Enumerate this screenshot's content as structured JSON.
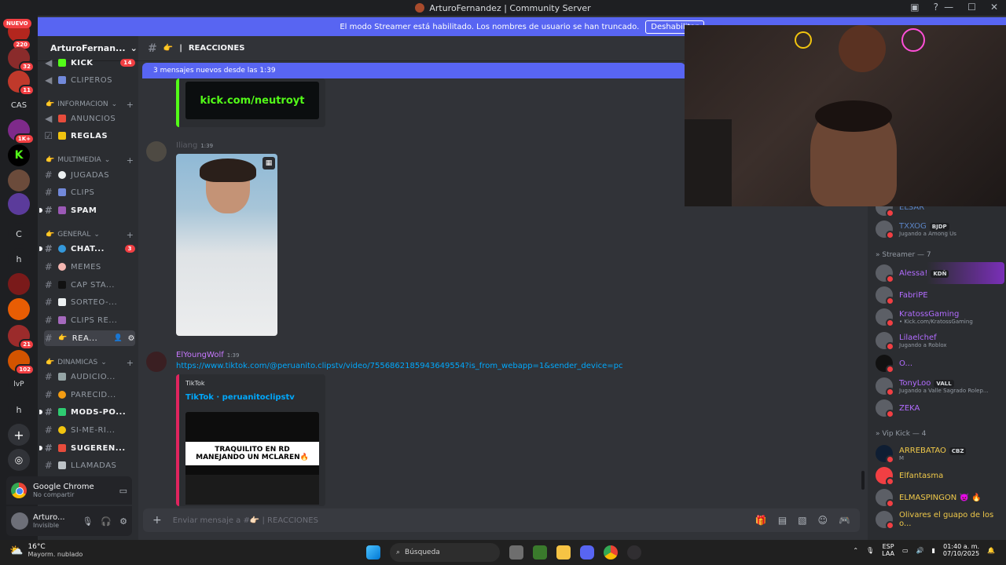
{
  "window": {
    "title": "ArturoFernandez | Community Server"
  },
  "banner": {
    "text": "El modo Streamer está habilitado. Los nombres de usuario se han truncado.",
    "button": "Deshabilitar"
  },
  "rail": {
    "nuevo": "NUEVO",
    "badge_220": "220",
    "badge_32": "32",
    "badge_11": "11",
    "cas": "CAS",
    "badge_1k": "1K+",
    "c": "C",
    "h": "h",
    "badge_21": "21",
    "badge_102": "102",
    "lvp": "lvP",
    "h2": "h"
  },
  "guild": {
    "name": "ArturoFernan..."
  },
  "channels": {
    "kick": "KICK",
    "kick_badge": "14",
    "clipers": "CLIPEROS",
    "cat_info": "INFORMACION",
    "anuncios": "ANUNCIOS",
    "reglas": "REGLAS",
    "cat_multi": "MULTIMEDIA",
    "jugadas": "JUGADAS",
    "clips": "CLIPS",
    "spam": "SPAM",
    "cat_general": "GENERAL",
    "chat": "CHAT...",
    "chat_badge": "3",
    "memes": "MEMES",
    "capsta": "CAP STA...",
    "sorteo": "SORTEO-...",
    "clipsre": "CLIPS RE...",
    "rea": "REA...",
    "cat_din": "DINAMICAS",
    "audicio": "AUDICIO...",
    "parecid": "PARECID...",
    "mods": "MODS-PO...",
    "sime": "SI-ME-RI...",
    "sugeren": "SUGEREN...",
    "llamadas": "LLAMADAS"
  },
  "share_panel": {
    "title": "Google Chrome",
    "subtitle": "No compartir"
  },
  "user_panel": {
    "name": "Arturo...",
    "status": "Invisible"
  },
  "chat": {
    "channel": "REACCIONES",
    "new_messages": "3 mensajes nuevos desde las 1:39",
    "kick_embed_text": "kick.com/neutroyt",
    "msg1_author": "Iliang",
    "msg1_time": "1:39",
    "msg2_author": "ElYoungWolf",
    "msg2_time": "1:39",
    "msg2_link": "https://www.tiktok.com/@peruanito.clipstv/video/7556862185943649554?is_from_webapp=1&sender_device=pc",
    "embed_provider": "TikTok",
    "embed_title": "TikTok · peruanitoclipstv",
    "thumb_line1": "TRAQUILITO EN RD",
    "thumb_line2": "MANEJANDO UN MCLAREN🔥",
    "composer_placeholder": "Enviar mensaje a #👉🏻 | REACCIONES"
  },
  "members": {
    "m_elsar": "ELSAR",
    "m_txxog": "TXXOG",
    "m_txxog_tag": "BJDP",
    "m_txxog_act": "Jugando a Among Us",
    "group_streamer": "» Streamer — 7",
    "m_alessa": "Alessa!",
    "m_alessa_tag": "KDÑ",
    "m_fabri": "FabriPE",
    "m_kratoss": "KratossGaming",
    "m_kratoss_act": "• Kick.com/KratossGaming",
    "m_lilael": "Lilaelchef",
    "m_lilael_act": "Jugando a Roblox",
    "m_o": "O...",
    "m_tony": "TonyLoo",
    "m_tony_tag": "VALL",
    "m_tony_act": "Jugando a Valle Sagrado Rolep...",
    "m_zeka": "ZEKA",
    "group_vip": "» Vip Kick — 4",
    "m_arrebatao": "ARREBATAO",
    "m_arrebatao_tag": "CBZ",
    "m_arrebatao_act": "M",
    "m_elfantasma": "Elfantasma",
    "m_elmaspingon": "ELMASPINGON 👿 🔥",
    "m_olivares": "Olivares el guapo de los o..."
  },
  "taskbar": {
    "temp": "16°C",
    "weather": "Mayorm. nublado",
    "search": "Búsqueda",
    "lang1": "ESP",
    "lang2": "LAA",
    "time": "01:40 a. m.",
    "date": "07/10/2025"
  },
  "colors": {
    "accent": "#5865f2",
    "mention": "#f23f43",
    "link": "#00a8fc",
    "streamer": "#b26cff",
    "vip": "#f0c94a",
    "tiktok_border": "#e0245e"
  }
}
